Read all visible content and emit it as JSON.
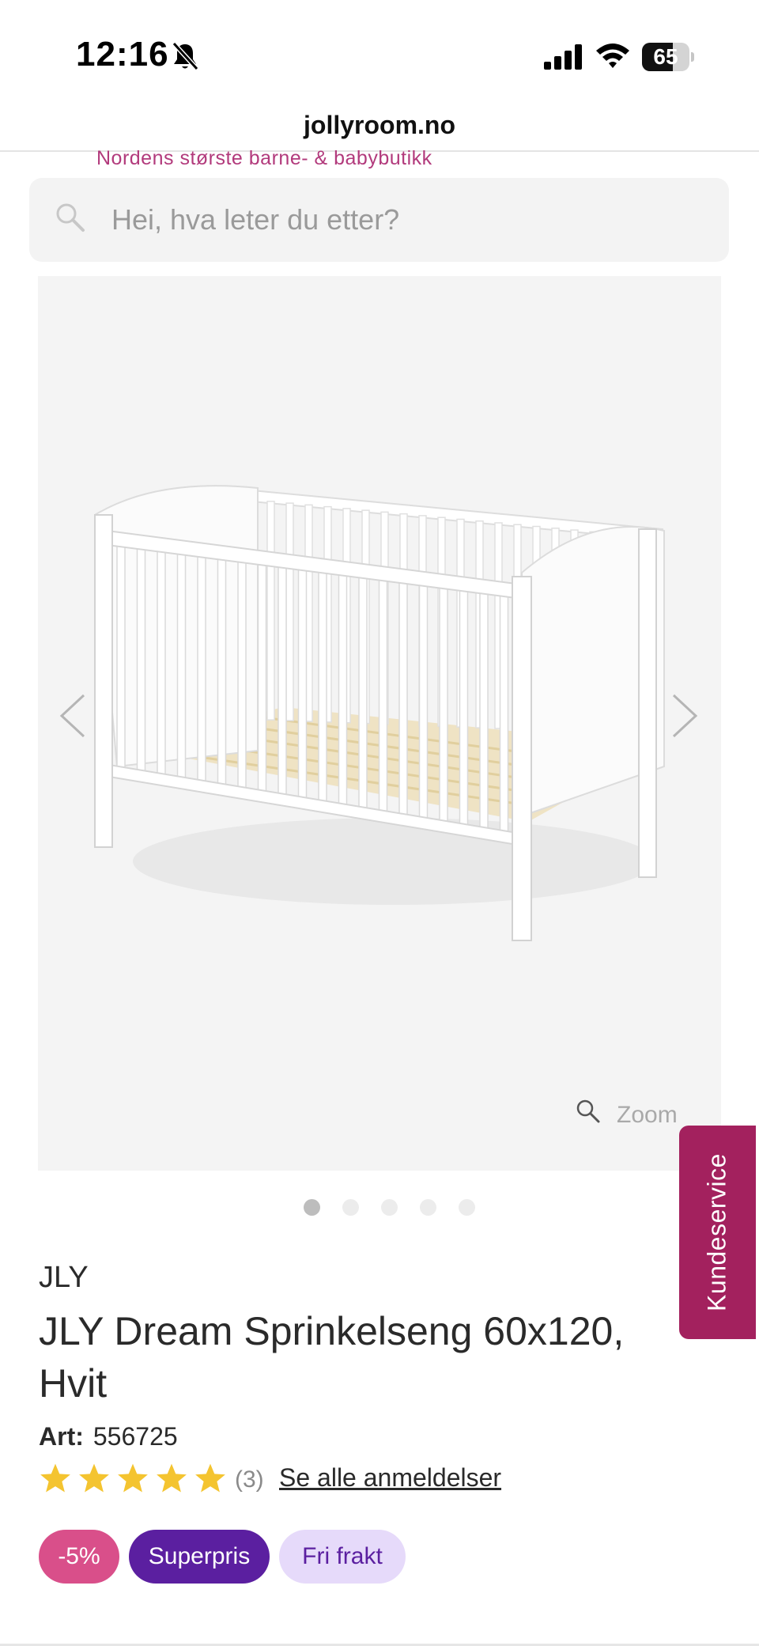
{
  "status_bar": {
    "time": "12:16",
    "battery": "65",
    "battery_level": 0.65,
    "icons": [
      "bell-slash-icon",
      "cellular-signal-icon",
      "wifi-icon",
      "battery-icon"
    ]
  },
  "browser": {
    "url": "jollyroom.no"
  },
  "header": {
    "tagline": "Nordens største barne- & babybutikk"
  },
  "search": {
    "placeholder": "Hei, hva leter du etter?",
    "icon": "search-icon"
  },
  "gallery": {
    "zoom_label": "Zoom",
    "image_count": 5,
    "active_index": 0,
    "icons": [
      "chevron-left-icon",
      "chevron-right-icon",
      "zoom-icon"
    ]
  },
  "support_tab": {
    "label": "Kundeservice"
  },
  "product": {
    "brand": "JLY",
    "title": "JLY Dream Sprinkelseng 60x120, Hvit",
    "art_label": "Art:",
    "art_number": "556725",
    "rating": 5,
    "review_count": "(3)",
    "reviews_link": "Se alle anmeldelser"
  },
  "badges": {
    "discount": "-5%",
    "superpris": "Superpris",
    "fri_frakt": "Fri frakt"
  },
  "colors": {
    "brand_pink": "#b23a7c",
    "support_tab": "#a3215e",
    "discount_badge": "#d94f8a",
    "superpris_badge": "#5b1fa0",
    "fri_frakt_badge": "#e6dafa",
    "star": "#f4c430"
  }
}
